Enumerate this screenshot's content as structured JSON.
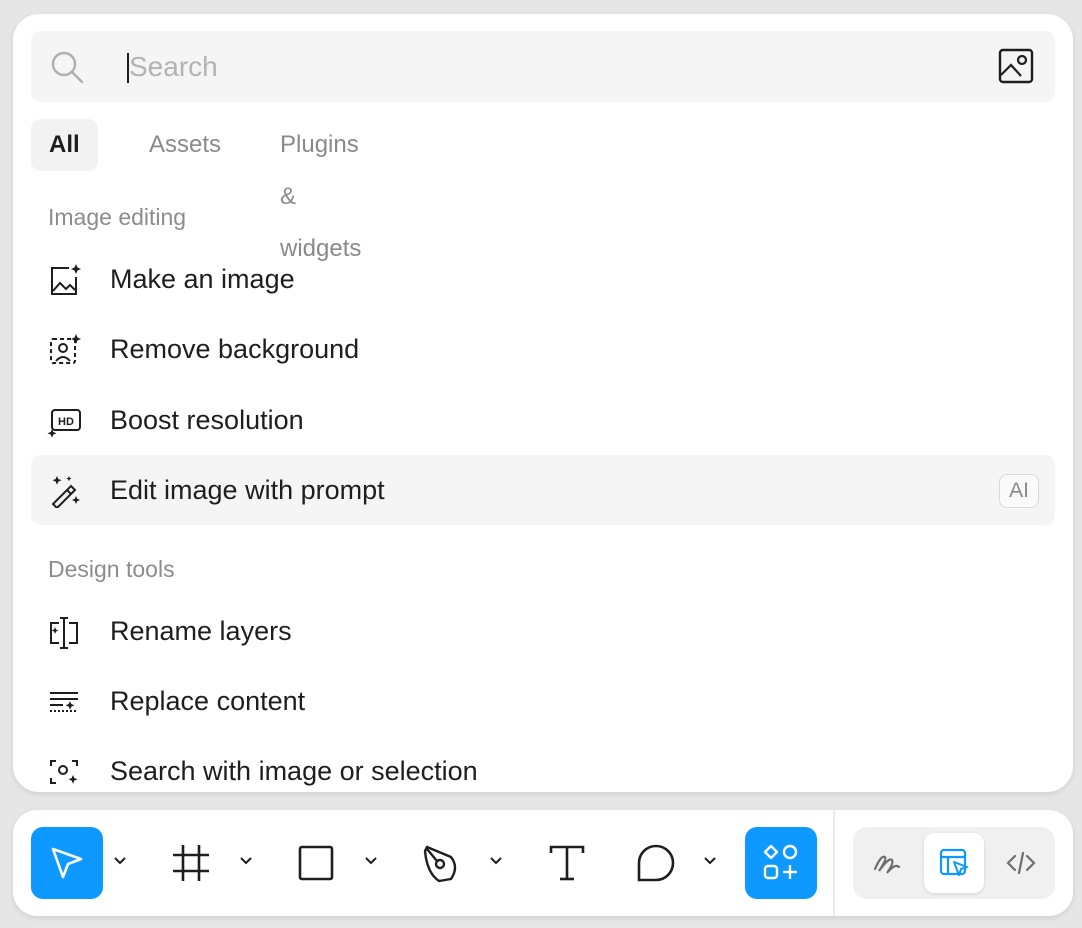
{
  "search": {
    "placeholder": "Search",
    "value": ""
  },
  "tabs": [
    {
      "label": "All",
      "active": true
    },
    {
      "label": "Assets",
      "active": false
    },
    {
      "label": "Plugins & widgets",
      "active": false
    }
  ],
  "sections": [
    {
      "title": "Image editing",
      "items": [
        {
          "label": "Make an image",
          "icon": "image-sparkle-icon"
        },
        {
          "label": "Remove background",
          "icon": "remove-background-icon"
        },
        {
          "label": "Boost resolution",
          "icon": "hd-sparkle-icon"
        },
        {
          "label": "Edit image with prompt",
          "icon": "magic-wand-icon",
          "badge": "AI",
          "highlighted": true
        }
      ]
    },
    {
      "title": "Design tools",
      "items": [
        {
          "label": "Rename layers",
          "icon": "rename-layers-icon"
        },
        {
          "label": "Replace content",
          "icon": "replace-content-icon"
        },
        {
          "label": "Search with image or selection",
          "icon": "visual-search-icon"
        }
      ]
    }
  ],
  "toolbar": {
    "tools": [
      "move-tool",
      "frame-tool",
      "rectangle-tool",
      "pen-tool",
      "text-tool",
      "comment-tool",
      "actions-tool"
    ],
    "active_tool": "move-tool",
    "modes": [
      "draw-mode",
      "design-mode",
      "dev-mode"
    ],
    "active_mode": "design-mode",
    "accent_color": "#0d99ff"
  }
}
